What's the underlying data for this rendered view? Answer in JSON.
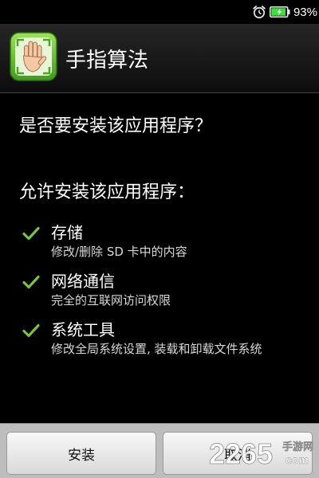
{
  "status_bar": {
    "battery_percent": "93%",
    "battery_level": 0.93,
    "battery_color": "#3ee03e"
  },
  "title_bar": {
    "app_name": "手指算法",
    "icon": "hand-icon",
    "icon_color": "#5ec62a"
  },
  "content": {
    "question": "是否要安装该应用程序？",
    "permissions_heading": "允许安装该应用程序：",
    "permissions": [
      {
        "icon": "check-icon",
        "title": "存储",
        "description": "修改/删除 SD 卡中的内容"
      },
      {
        "icon": "check-icon",
        "title": "网络通信",
        "description": "完全的互联网访问权限"
      },
      {
        "icon": "check-icon",
        "title": "系统工具",
        "description": "修改全局系统设置, 装载和卸载文件系统"
      }
    ],
    "check_color": "#7bc142"
  },
  "buttons": {
    "install_label": "安装",
    "cancel_label": "取消"
  },
  "watermark": {
    "number": "2265",
    "cn_text": "手游网",
    "domain": "com"
  }
}
